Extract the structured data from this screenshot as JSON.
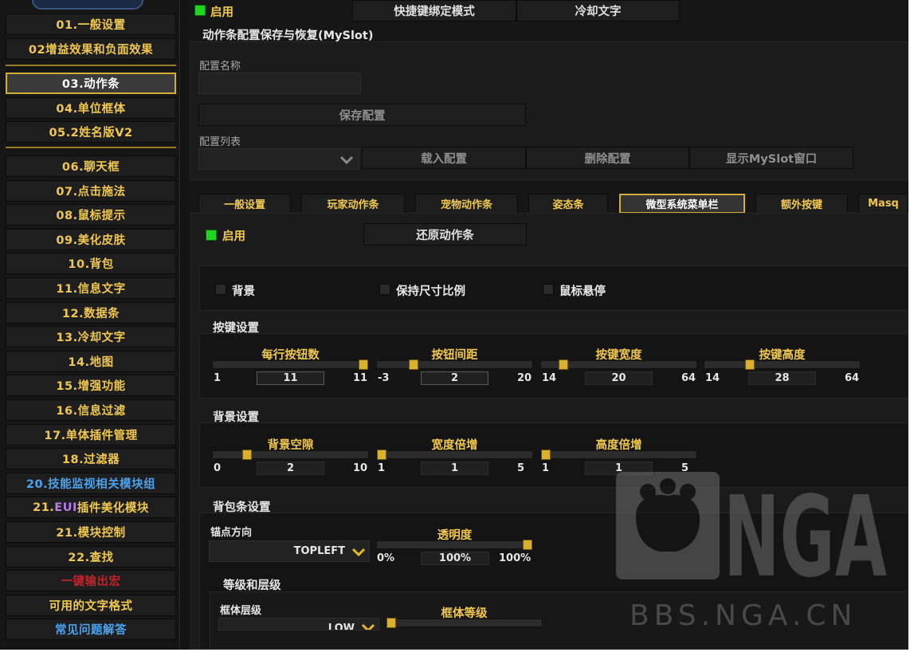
{
  "sidebar": {
    "items": [
      {
        "label": "01.一般设置"
      },
      {
        "label": "02增益效果和负面效果"
      },
      {
        "label": "03.动作条"
      },
      {
        "label": "04.单位框体"
      },
      {
        "label": "05.2姓名版V2"
      },
      {
        "label": "06.聊天框"
      },
      {
        "label": "07.点击施法"
      },
      {
        "label": "08.鼠标提示"
      },
      {
        "label": "09.美化皮肤"
      },
      {
        "label": "10.背包"
      },
      {
        "label": "11.信息文字"
      },
      {
        "label": "12.数据条"
      },
      {
        "label": "13.冷却文字"
      },
      {
        "label": "14.地图"
      },
      {
        "label": "15.增强功能"
      },
      {
        "label": "16.信息过滤"
      },
      {
        "label": "17.单体插件管理"
      },
      {
        "label": "18.过滤器"
      },
      {
        "label": "20.技能监视相关模块组"
      },
      {
        "label_prefix": "21.",
        "label_eui": "EUI",
        "label_suffix": "插件美化模块"
      },
      {
        "label": "21.模块控制"
      },
      {
        "label": "22.查找"
      },
      {
        "label": "一键输出宏"
      },
      {
        "label": "可用的文字格式"
      },
      {
        "label": "常见问题解答"
      }
    ],
    "colors": {
      "gold": "#f0c850",
      "blue": "#4aa3f0",
      "red": "#c0242a",
      "purple": "#b57ee8"
    }
  },
  "top": {
    "enable_label": "启用",
    "enabled": true,
    "keybind_button": "快捷键绑定模式",
    "cooldown_button": "冷却文字"
  },
  "myslot": {
    "title": "动作条配置保存与恢复(MySlot)",
    "name_label": "配置名称",
    "name_value": "",
    "save_button": "保存配置",
    "list_label": "配置列表",
    "list_value": "",
    "load_button": "载入配置",
    "delete_button": "删除配置",
    "show_button": "显示MySlot窗口"
  },
  "tabs": [
    {
      "label": "一般设置"
    },
    {
      "label": "玩家动作条"
    },
    {
      "label": "宠物动作条"
    },
    {
      "label": "姿态条"
    },
    {
      "label": "微型系统菜单栏"
    },
    {
      "label": "额外按键"
    },
    {
      "label": "Masq"
    }
  ],
  "microbar": {
    "enable_label": "启用",
    "enabled": true,
    "restore_button": "还原动作条",
    "options": {
      "background": "背景",
      "keep_ratio": "保持尺寸比例",
      "mouseover": "鼠标悬停"
    },
    "key_settings": {
      "title": "按键设置",
      "sliders": [
        {
          "name": "每行按钮数",
          "min": "1",
          "max": "11",
          "value": "11",
          "fraction": 1.0
        },
        {
          "name": "按钮间距",
          "min": "-3",
          "max": "20",
          "value": "2",
          "fraction": 0.22
        },
        {
          "name": "按键宽度",
          "min": "14",
          "max": "64",
          "value": "20",
          "fraction": 0.12
        },
        {
          "name": "按键高度",
          "min": "14",
          "max": "64",
          "value": "28",
          "fraction": 0.28
        }
      ]
    },
    "bg_settings": {
      "title": "背景设置",
      "sliders": [
        {
          "name": "背景空隙",
          "min": "0",
          "max": "10",
          "value": "2",
          "fraction": 0.2
        },
        {
          "name": "宽度倍增",
          "min": "1",
          "max": "5",
          "value": "1",
          "fraction": 0.0
        },
        {
          "name": "高度倍增",
          "min": "1",
          "max": "5",
          "value": "1",
          "fraction": 0.0
        }
      ]
    },
    "bag_settings": {
      "title": "背包条设置",
      "anchor_label": "锚点方向",
      "anchor_value": "TOPLEFT",
      "alpha": {
        "name": "透明度",
        "min": "0%",
        "max": "100%",
        "value": "100%",
        "fraction": 1.0
      }
    },
    "strata": {
      "title": "等级和层级",
      "frame_strata_label": "框体层级",
      "frame_strata_value": "LOW",
      "frame_level": {
        "name": "框体等级",
        "fraction": 0.0
      }
    }
  },
  "watermark": {
    "logo": "NGA",
    "site": "BBS.NGA.CN"
  }
}
